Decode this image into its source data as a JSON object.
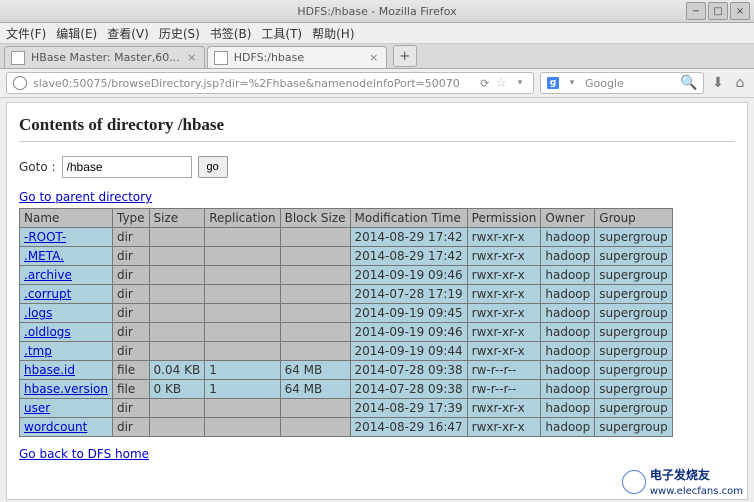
{
  "window": {
    "title": "HDFS:/hbase - Mozilla Firefox",
    "controls": {
      "min": "−",
      "max": "□",
      "close": "×"
    }
  },
  "menubar": {
    "file": "文件(F)",
    "edit": "编辑(E)",
    "view": "查看(V)",
    "history": "历史(S)",
    "bookmarks": "书签(B)",
    "tools": "工具(T)",
    "help": "帮助(H)"
  },
  "tabs": [
    {
      "label": "HBase Master: Master,60..."
    },
    {
      "label": "HDFS:/hbase"
    }
  ],
  "newtab_label": "+",
  "urlbar": {
    "url": "slave0:50075/browseDirectory.jsp?dir=%2Fhbase&namenodeInfoPort=50070",
    "star": "☆",
    "dropdown": "▾",
    "reload_icon": "⟳"
  },
  "searchbar": {
    "engine": "g",
    "placeholder": "Google",
    "dropdown": "▾"
  },
  "toolbar_icons": {
    "search": "🔍",
    "download": "⬇",
    "home": "⌂"
  },
  "page": {
    "heading": "Contents of directory /hbase",
    "goto_label": "Goto :",
    "goto_value": "/hbase",
    "go_button": "go",
    "parent_link": "Go to parent directory",
    "home_link": "Go back to DFS home",
    "columns": [
      "Name",
      "Type",
      "Size",
      "Replication",
      "Block Size",
      "Modification Time",
      "Permission",
      "Owner",
      "Group"
    ],
    "rows": [
      {
        "name": "-ROOT-",
        "type": "dir",
        "size": "",
        "repl": "",
        "block": "",
        "mtime": "2014-08-29 17:42",
        "perm": "rwxr-xr-x",
        "owner": "hadoop",
        "group": "supergroup"
      },
      {
        "name": ".META.",
        "type": "dir",
        "size": "",
        "repl": "",
        "block": "",
        "mtime": "2014-08-29 17:42",
        "perm": "rwxr-xr-x",
        "owner": "hadoop",
        "group": "supergroup"
      },
      {
        "name": ".archive",
        "type": "dir",
        "size": "",
        "repl": "",
        "block": "",
        "mtime": "2014-09-19 09:46",
        "perm": "rwxr-xr-x",
        "owner": "hadoop",
        "group": "supergroup"
      },
      {
        "name": ".corrupt",
        "type": "dir",
        "size": "",
        "repl": "",
        "block": "",
        "mtime": "2014-07-28 17:19",
        "perm": "rwxr-xr-x",
        "owner": "hadoop",
        "group": "supergroup"
      },
      {
        "name": ".logs",
        "type": "dir",
        "size": "",
        "repl": "",
        "block": "",
        "mtime": "2014-09-19 09:45",
        "perm": "rwxr-xr-x",
        "owner": "hadoop",
        "group": "supergroup"
      },
      {
        "name": ".oldlogs",
        "type": "dir",
        "size": "",
        "repl": "",
        "block": "",
        "mtime": "2014-09-19 09:46",
        "perm": "rwxr-xr-x",
        "owner": "hadoop",
        "group": "supergroup"
      },
      {
        "name": ".tmp",
        "type": "dir",
        "size": "",
        "repl": "",
        "block": "",
        "mtime": "2014-09-19 09:44",
        "perm": "rwxr-xr-x",
        "owner": "hadoop",
        "group": "supergroup"
      },
      {
        "name": "hbase.id",
        "type": "file",
        "size": "0.04 KB",
        "repl": "1",
        "block": "64 MB",
        "mtime": "2014-07-28 09:38",
        "perm": "rw-r--r--",
        "owner": "hadoop",
        "group": "supergroup"
      },
      {
        "name": "hbase.version",
        "type": "file",
        "size": "0 KB",
        "repl": "1",
        "block": "64 MB",
        "mtime": "2014-07-28 09:38",
        "perm": "rw-r--r--",
        "owner": "hadoop",
        "group": "supergroup"
      },
      {
        "name": "user",
        "type": "dir",
        "size": "",
        "repl": "",
        "block": "",
        "mtime": "2014-08-29 17:39",
        "perm": "rwxr-xr-x",
        "owner": "hadoop",
        "group": "supergroup"
      },
      {
        "name": "wordcount",
        "type": "dir",
        "size": "",
        "repl": "",
        "block": "",
        "mtime": "2014-08-29 16:47",
        "perm": "rwxr-xr-x",
        "owner": "hadoop",
        "group": "supergroup"
      }
    ]
  },
  "watermark": {
    "brand": "电子发烧友",
    "url": "www.elecfans.com"
  }
}
